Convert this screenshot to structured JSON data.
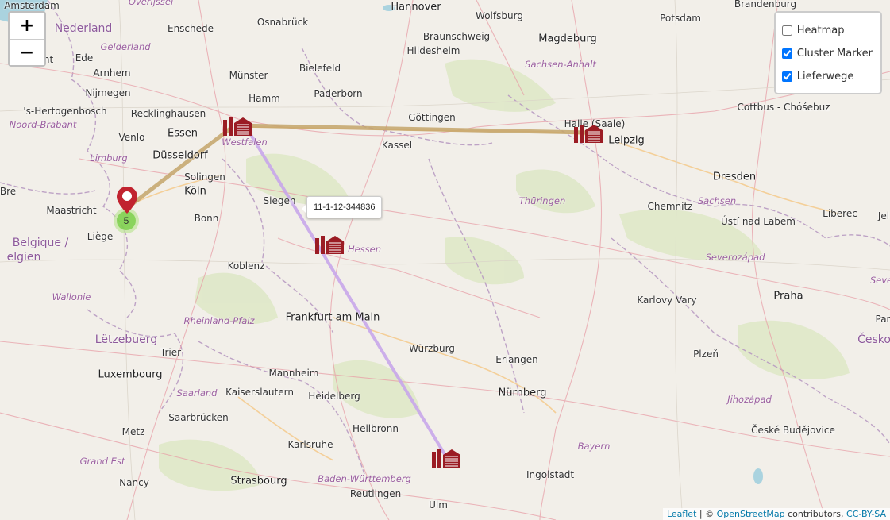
{
  "map": {
    "zoom_in_label": "+",
    "zoom_out_label": "−",
    "layers": [
      {
        "label": "Heatmap",
        "checked": false
      },
      {
        "label": "Cluster Marker",
        "checked": true
      },
      {
        "label": "Lieferwege",
        "checked": true
      }
    ],
    "tooltip": "11-1-12-344836",
    "cluster_count": "5",
    "attribution": {
      "leaflet": "Leaflet",
      "sep1": " | © ",
      "osm": "OpenStreetMap",
      "contrib": " contributors, ",
      "license": "CC-BY-SA"
    },
    "route_colors": {
      "north": "#c4a46a",
      "south": "#c8a6ea"
    },
    "marker_color": "#9b1c24",
    "warehouse_icon": "warehouse-icon",
    "cities": [
      {
        "name": "Amsterdam"
      },
      {
        "name": "Hannover",
        "big": true
      },
      {
        "name": "Wolfsburg"
      },
      {
        "name": "Potsdam"
      },
      {
        "name": "Brandenburg"
      },
      {
        "name": "Enschede"
      },
      {
        "name": "Osnabrück"
      },
      {
        "name": "Braunschweig"
      },
      {
        "name": "Magdeburg",
        "big": true
      },
      {
        "name": "Hildesheim"
      },
      {
        "name": "Arnhem"
      },
      {
        "name": "Ede"
      },
      {
        "name": "Utrecht"
      },
      {
        "name": "Münster"
      },
      {
        "name": "Bielefeld"
      },
      {
        "name": "Nijmegen"
      },
      {
        "name": "Hamm"
      },
      {
        "name": "Paderborn"
      },
      {
        "name": "'s-Hertogenbosch"
      },
      {
        "name": "Recklinghausen"
      },
      {
        "name": "Göttingen"
      },
      {
        "name": "Cottbus - Chóśebuz"
      },
      {
        "name": "Halle (Saale)"
      },
      {
        "name": "Leipzig",
        "big": true
      },
      {
        "name": "Essen",
        "big": true
      },
      {
        "name": "Venlo"
      },
      {
        "name": "Kassel"
      },
      {
        "name": "Düsseldorf",
        "big": true
      },
      {
        "name": "Dresden",
        "big": true
      },
      {
        "name": "Solingen"
      },
      {
        "name": "Köln",
        "big": true
      },
      {
        "name": "Siegen"
      },
      {
        "name": "Maastricht"
      },
      {
        "name": "Bonn"
      },
      {
        "name": "Chemnitz"
      },
      {
        "name": "Ústí nad Labem"
      },
      {
        "name": "Liberec"
      },
      {
        "name": "Liège"
      },
      {
        "name": "Koblenz"
      },
      {
        "name": "Karlovy Vary"
      },
      {
        "name": "Praha",
        "big": true
      },
      {
        "name": "Frankfurt am Main",
        "big": true
      },
      {
        "name": "Trier"
      },
      {
        "name": "Würzburg"
      },
      {
        "name": "Luxembourg",
        "big": true
      },
      {
        "name": "Erlangen"
      },
      {
        "name": "Plzeň"
      },
      {
        "name": "Mannheim"
      },
      {
        "name": "Kaiserslautern"
      },
      {
        "name": "Heidelberg"
      },
      {
        "name": "Nürnberg",
        "big": true
      },
      {
        "name": "Saarbrücken"
      },
      {
        "name": "Metz"
      },
      {
        "name": "Heilbronn"
      },
      {
        "name": "České Budějovice"
      },
      {
        "name": "Karlsruhe"
      },
      {
        "name": "Ingolstadt"
      },
      {
        "name": "Nancy"
      },
      {
        "name": "Strasbourg",
        "big": true
      },
      {
        "name": "Reutlingen"
      },
      {
        "name": "Ulm"
      },
      {
        "name": "Jel"
      },
      {
        "name": "Par"
      },
      {
        "name": "Bre"
      }
    ],
    "regions": [
      {
        "name": "Overijssel"
      },
      {
        "name": "Gelderland"
      },
      {
        "name": "Noord-Brabant"
      },
      {
        "name": "Limburg"
      },
      {
        "name": "Sachsen-Anhalt"
      },
      {
        "name": "Westfalen"
      },
      {
        "name": "Thüringen"
      },
      {
        "name": "Sachsen"
      },
      {
        "name": "Hessen"
      },
      {
        "name": "Wallonie"
      },
      {
        "name": "Severozápad"
      },
      {
        "name": "Seve"
      },
      {
        "name": "Rheinland-Pfalz"
      },
      {
        "name": "Saarland"
      },
      {
        "name": "Jihozápad"
      },
      {
        "name": "Grand Est"
      },
      {
        "name": "Bayern"
      },
      {
        "name": "Baden-Württemberg"
      }
    ],
    "countries": [
      {
        "name": "Nederland"
      },
      {
        "name": "Belgique /"
      },
      {
        "name": "elgien"
      },
      {
        "name": "Lëtzebuerg"
      },
      {
        "name": "Česko"
      }
    ]
  }
}
